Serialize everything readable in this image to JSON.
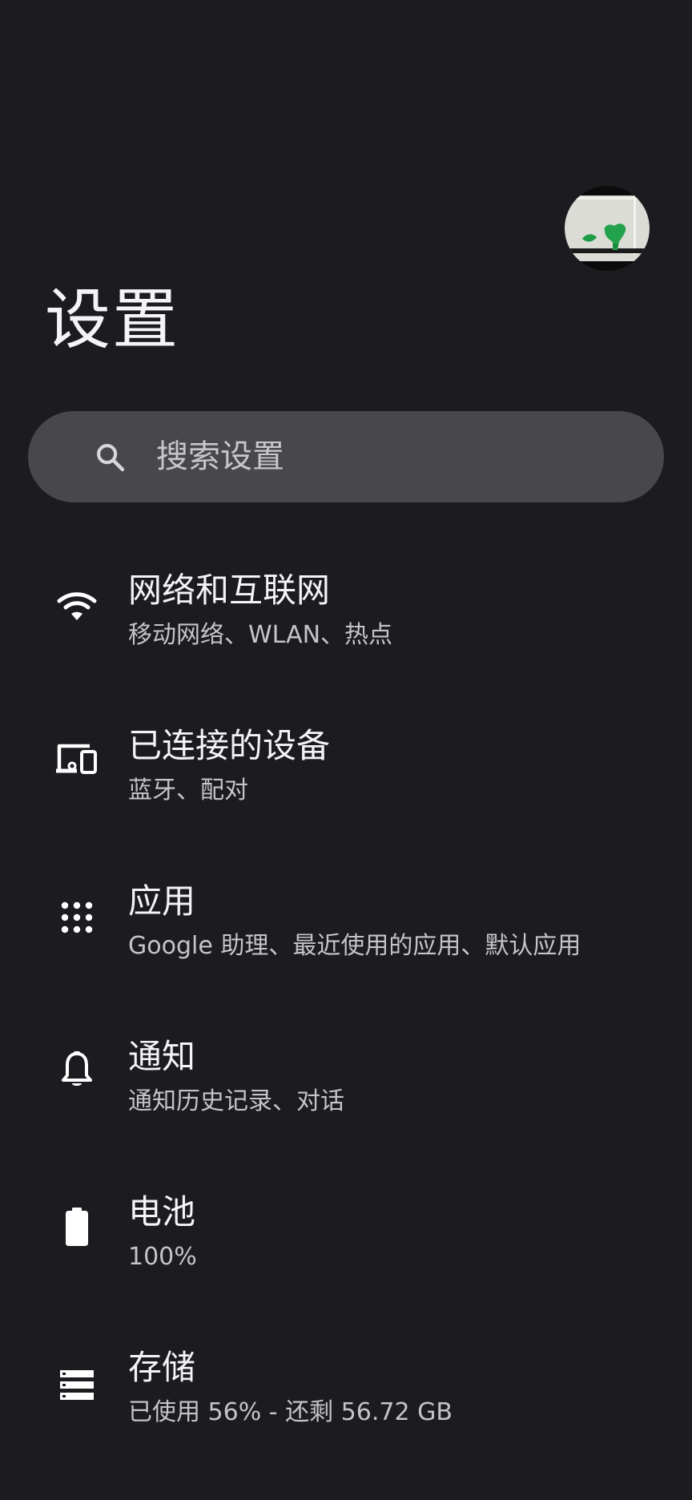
{
  "header": {
    "title": "设置"
  },
  "search": {
    "placeholder": "搜索设置",
    "icon": "search-icon"
  },
  "settings_items": [
    {
      "title": "网络和互联网",
      "subtitle": "移动网络、WLAN、热点",
      "icon": "wifi-icon"
    },
    {
      "title": "已连接的设备",
      "subtitle": "蓝牙、配对",
      "icon": "connected-devices-icon"
    },
    {
      "title": "应用",
      "subtitle": "Google 助理、最近使用的应用、默认应用",
      "icon": "apps-grid-icon"
    },
    {
      "title": "通知",
      "subtitle": "通知历史记录、对话",
      "icon": "bell-icon"
    },
    {
      "title": "电池",
      "subtitle": "100%",
      "icon": "battery-icon"
    },
    {
      "title": "存储",
      "subtitle": "已使用 56% - 还剩 56.72 GB",
      "icon": "storage-icon"
    }
  ],
  "colors": {
    "background": "#1c1b20",
    "search_background": "#48474c",
    "primary_text": "#f4f3f7",
    "secondary_text": "#c6c4ca"
  }
}
